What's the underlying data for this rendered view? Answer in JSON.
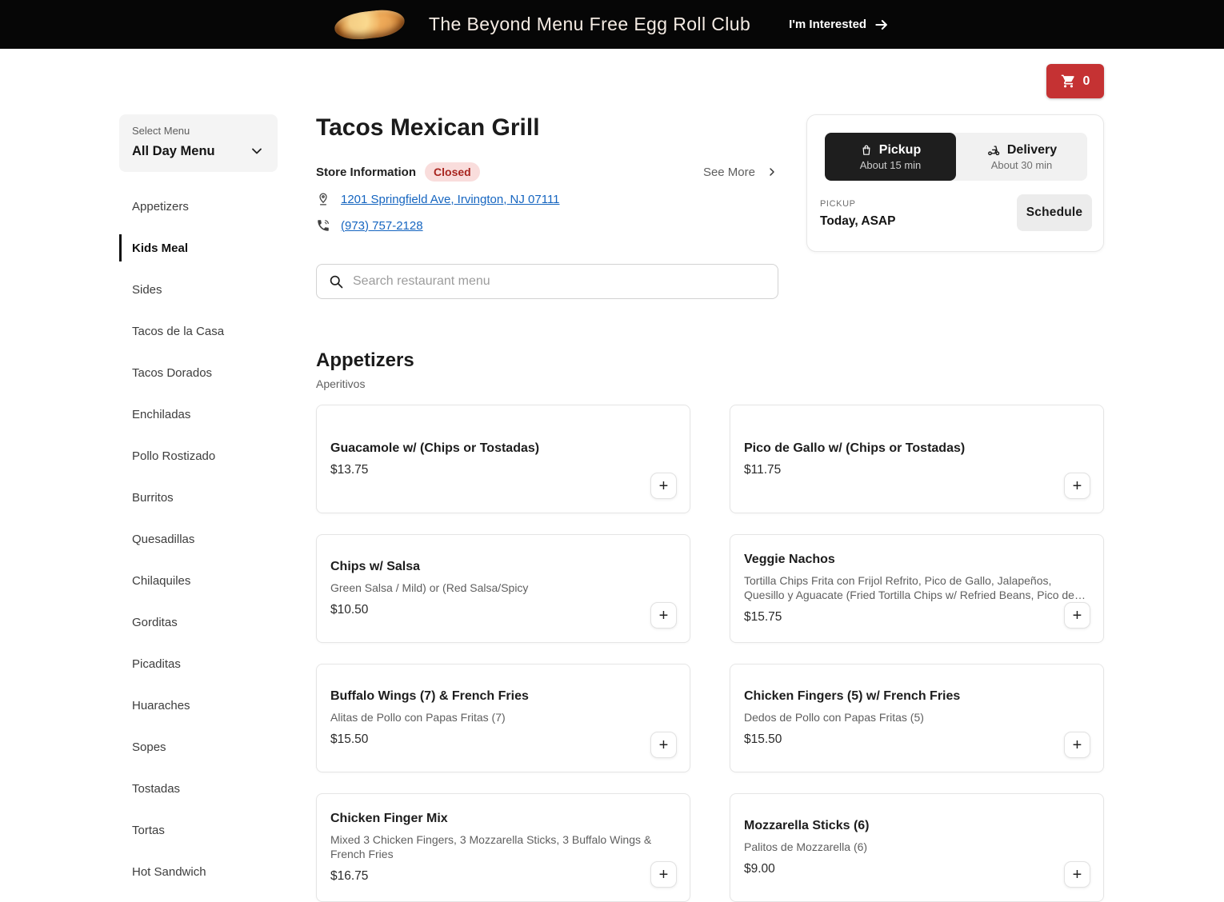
{
  "banner": {
    "title": "The Beyond Menu Free Egg Roll Club",
    "cta_label": "I'm Interested"
  },
  "cart": {
    "count": "0"
  },
  "sidebar": {
    "select_label": "Select Menu",
    "selected_menu": "All Day Menu",
    "items": [
      {
        "label": "Appetizers",
        "active": false
      },
      {
        "label": "Kids Meal",
        "active": true
      },
      {
        "label": "Sides",
        "active": false
      },
      {
        "label": "Tacos de la Casa",
        "active": false
      },
      {
        "label": "Tacos Dorados",
        "active": false
      },
      {
        "label": "Enchiladas",
        "active": false
      },
      {
        "label": "Pollo Rostizado",
        "active": false
      },
      {
        "label": "Burritos",
        "active": false
      },
      {
        "label": "Quesadillas",
        "active": false
      },
      {
        "label": "Chilaquiles",
        "active": false
      },
      {
        "label": "Gorditas",
        "active": false
      },
      {
        "label": "Picaditas",
        "active": false
      },
      {
        "label": "Huaraches",
        "active": false
      },
      {
        "label": "Sopes",
        "active": false
      },
      {
        "label": "Tostadas",
        "active": false
      },
      {
        "label": "Tortas",
        "active": false
      },
      {
        "label": "Hot Sandwich",
        "active": false
      }
    ]
  },
  "restaurant": {
    "name": "Tacos Mexican Grill",
    "store_info_label": "Store Information",
    "status": "Closed",
    "see_more_label": "See More",
    "address": "1201 Springfield Ave, Irvington, NJ 07111",
    "phone": "(973) 757-2128"
  },
  "search": {
    "placeholder": "Search restaurant menu"
  },
  "order_panel": {
    "pickup_label": "Pickup",
    "pickup_eta": "About 15 min",
    "delivery_label": "Delivery",
    "delivery_eta": "About 30 min",
    "mode_caption": "PICKUP",
    "time_value": "Today, ASAP",
    "schedule_label": "Schedule"
  },
  "menu_section": {
    "title": "Appetizers",
    "subtitle": "Aperitivos",
    "items": [
      {
        "name": "Guacamole w/ (Chips or Tostadas)",
        "description": "",
        "price": "$13.75"
      },
      {
        "name": "Pico de Gallo w/ (Chips or Tostadas)",
        "description": "",
        "price": "$11.75"
      },
      {
        "name": "Chips w/ Salsa",
        "description": "Green Salsa / Mild) or (Red Salsa/Spicy",
        "price": "$10.50"
      },
      {
        "name": "Veggie Nachos",
        "description": "Tortilla Chips Frita con Frijol Refrito, Pico de Gallo, Jalapeños, Quesillo y Aguacate (Fried Tortilla Chips w/ Refried Beans, Pico de…",
        "price": "$15.75"
      },
      {
        "name": "Buffalo Wings (7) & French Fries",
        "description": "Alitas de Pollo con Papas Fritas (7)",
        "price": "$15.50"
      },
      {
        "name": "Chicken Fingers (5) w/ French Fries",
        "description": "Dedos de Pollo con Papas Fritas (5)",
        "price": "$15.50"
      },
      {
        "name": "Chicken Finger Mix",
        "description": "Mixed 3 Chicken Fingers, 3 Mozzarella Sticks, 3 Buffalo Wings & French Fries",
        "price": "$16.75"
      },
      {
        "name": "Mozzarella Sticks (6)",
        "description": "Palitos de Mozzarella (6)",
        "price": "$9.00"
      }
    ]
  },
  "colors": {
    "banner_bg": "#060606",
    "cart_red": "#c53233",
    "closed_badge_bg": "#f9dddc",
    "closed_badge_text": "#a8251f",
    "link_blue": "#1565c0",
    "pickup_segment_bg": "#1e1e1e"
  },
  "icons": [
    "egg-roll-image",
    "arrow-right-icon",
    "cart-icon",
    "chevron-down-icon",
    "pin-icon",
    "phone-icon",
    "search-icon",
    "bag-icon",
    "scooter-icon",
    "chevron-right-icon",
    "plus-icon"
  ]
}
